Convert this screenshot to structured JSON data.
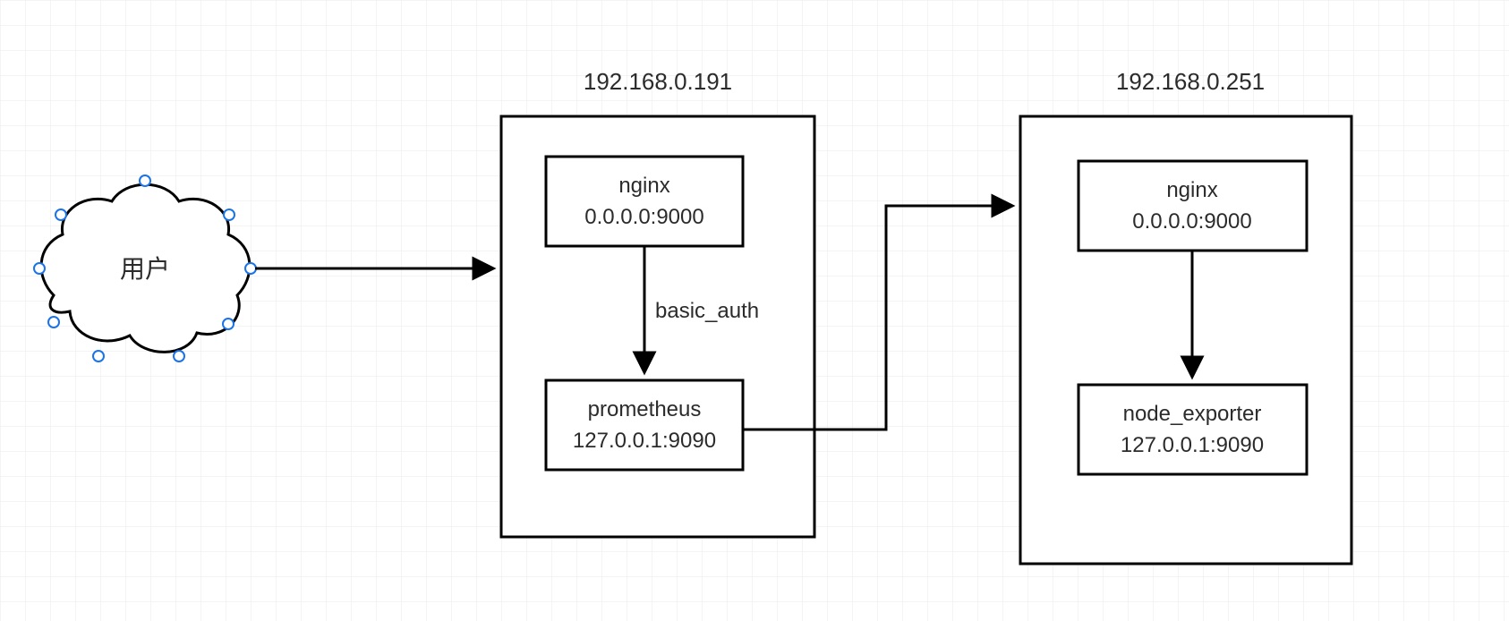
{
  "diagram": {
    "user_label": "用户",
    "server1": {
      "ip": "192.168.0.191",
      "nginx": {
        "name": "nginx",
        "bind": "0.0.0.0:9000"
      },
      "prometheus": {
        "name": "prometheus",
        "bind": "127.0.0.1:9090"
      },
      "edge_label": "basic_auth"
    },
    "server2": {
      "ip": "192.168.0.251",
      "nginx": {
        "name": "nginx",
        "bind": "0.0.0.0:9000"
      },
      "node_exporter": {
        "name": "node_exporter",
        "bind": "127.0.0.1:9090"
      }
    }
  }
}
